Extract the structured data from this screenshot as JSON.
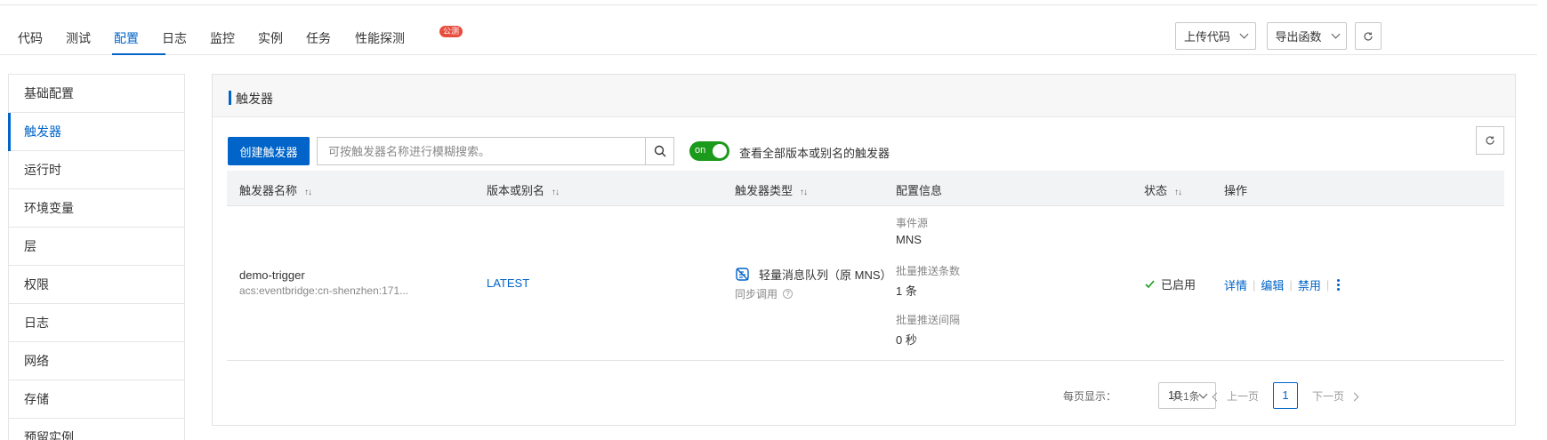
{
  "tabs": [
    {
      "label": "代码"
    },
    {
      "label": "测试"
    },
    {
      "label": "配置"
    },
    {
      "label": "日志"
    },
    {
      "label": "监控"
    },
    {
      "label": "实例"
    },
    {
      "label": "任务"
    },
    {
      "label": "性能探测"
    }
  ],
  "active_tab": "配置",
  "badge": "公测",
  "toolbar": {
    "upload_label": "上传代码",
    "export_label": "导出函数"
  },
  "sidebar": {
    "items": [
      {
        "label": "基础配置"
      },
      {
        "label": "触发器"
      },
      {
        "label": "运行时"
      },
      {
        "label": "环境变量"
      },
      {
        "label": "层"
      },
      {
        "label": "权限"
      },
      {
        "label": "日志"
      },
      {
        "label": "网络"
      },
      {
        "label": "存储"
      },
      {
        "label": "预留实例"
      }
    ],
    "active": "触发器"
  },
  "panel": {
    "title": "触发器",
    "create_label": "创建触发器",
    "search_placeholder": "可按触发器名称进行模糊搜索。",
    "toggle_text": "on",
    "toggle_label": "查看全部版本或别名的触发器"
  },
  "table": {
    "headers": [
      "触发器名称",
      "版本或别名",
      "触发器类型",
      "配置信息",
      "状态",
      "操作"
    ],
    "rows": [
      {
        "name": "demo-trigger",
        "arn": "acs:eventbridge:cn-shenzhen:171...",
        "version": "LATEST",
        "type": "轻量消息队列（原 MNS）",
        "invocation": "同步调用",
        "config": [
          {
            "label": "事件源",
            "value": "MNS"
          },
          {
            "label": "批量推送条数",
            "value": "1 条"
          },
          {
            "label": "批量推送间隔",
            "value": "0 秒"
          }
        ],
        "status": "已启用",
        "actions": [
          "详情",
          "编辑",
          "禁用"
        ]
      }
    ]
  },
  "pagination": {
    "per_page_label": "每页显示：",
    "per_page": "10",
    "total": "共1条",
    "prev": "上一页",
    "current": "1",
    "next": "下一页"
  },
  "colors": {
    "primary": "#0064c8",
    "toggle_on": "#1b9a1b",
    "status_ok": "#1b9a1b",
    "badge": "#e84c3d"
  }
}
